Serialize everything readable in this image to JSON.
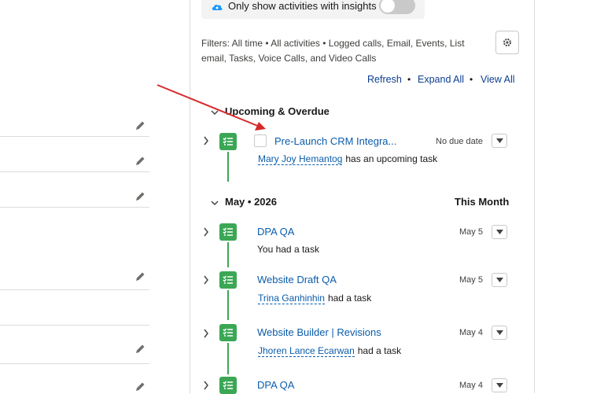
{
  "insights": {
    "label": "Only show activities with insights"
  },
  "filters": {
    "text": "Filters: All time • All activities • Logged calls, Email, Events, List email, Tasks, Voice Calls, and Video Calls"
  },
  "actions": {
    "refresh": "Refresh",
    "expand_all": "Expand All",
    "view_all": "View All"
  },
  "sections": {
    "upcoming": {
      "title": "Upcoming & Overdue"
    },
    "may": {
      "title": "May • 2026",
      "right": "This Month"
    }
  },
  "items": [
    {
      "title": "Pre-Launch CRM Integra...",
      "date": "No due date",
      "person": "Mary Joy Hemantog",
      "suffix": "has an upcoming task"
    },
    {
      "title": "DPA QA",
      "date": "May 5",
      "person": "",
      "suffix": "You had a task"
    },
    {
      "title": "Website Draft QA",
      "date": "May 5",
      "person": "Trina Ganhinhin",
      "suffix": "had a task"
    },
    {
      "title": "Website Builder | Revisions",
      "date": "May 4",
      "person": "Jhoren Lance Ecarwan",
      "suffix": "had a task"
    },
    {
      "title": "DPA QA",
      "date": "May 4",
      "person": "",
      "suffix": ""
    }
  ],
  "colors": {
    "task_green": "#3ba755",
    "link_blue": "#0b5cab",
    "annotation_red": "#d62a2a"
  }
}
